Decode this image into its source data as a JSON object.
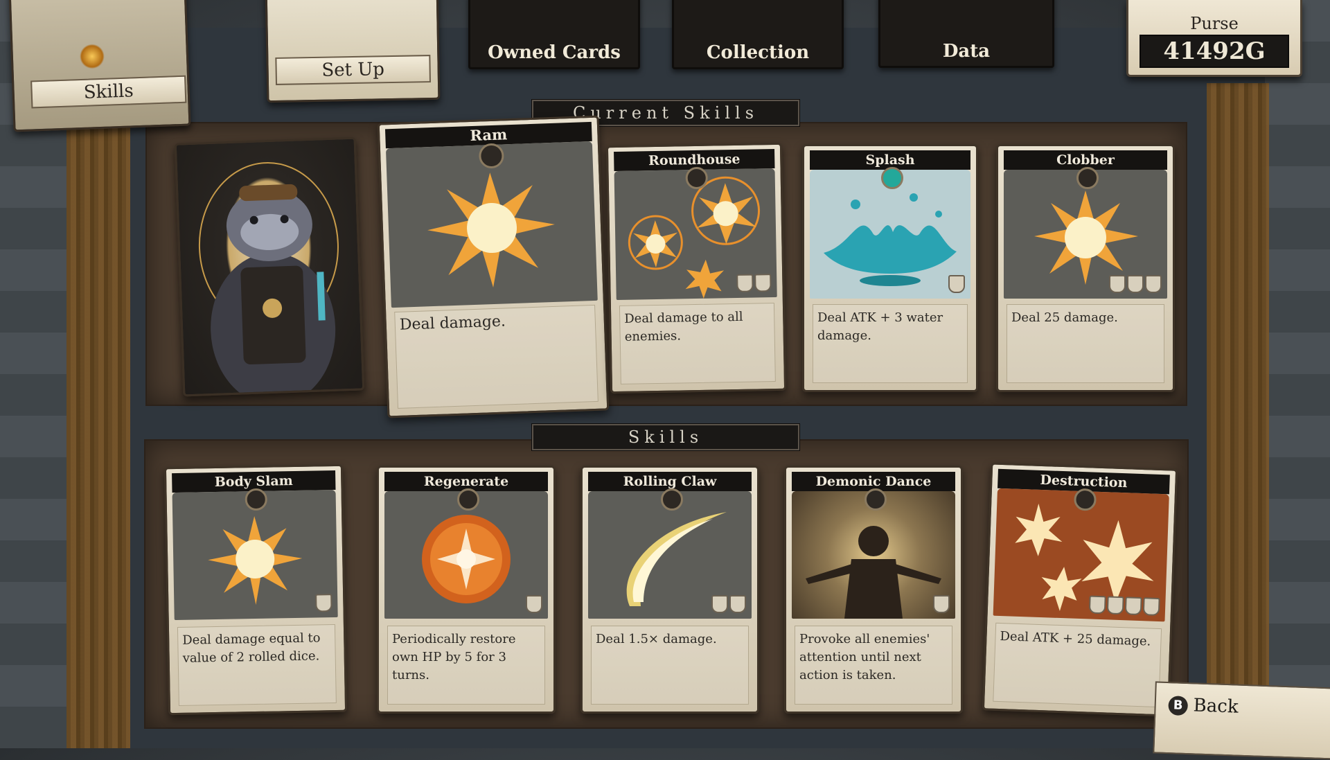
{
  "nav": {
    "skills": "Skills",
    "setup": "Set Up",
    "owned_cards": "Owned Cards",
    "collection": "Collection",
    "data": "Data"
  },
  "purse": {
    "label": "Purse",
    "amount": "41492G"
  },
  "sections": {
    "current": "Current Skills",
    "skills": "Skills"
  },
  "current_skills": [
    {
      "name": "Ram",
      "desc": "Deal damage.",
      "art": "burst-orange",
      "cost": 0
    },
    {
      "name": "Roundhouse",
      "desc": "Deal damage to all enemies.",
      "art": "burst-multi",
      "cost": 2
    },
    {
      "name": "Splash",
      "desc": "Deal ATK + 3 water damage.",
      "art": "splash-blue",
      "cost": 1
    },
    {
      "name": "Clobber",
      "desc": "Deal 25 damage.",
      "art": "burst-orange",
      "cost": 3
    }
  ],
  "skills": [
    {
      "name": "Body Slam",
      "desc": "Deal damage equal to value of 2 rolled dice.",
      "art": "burst-orange",
      "cost": 1
    },
    {
      "name": "Regenerate",
      "desc": "Periodically restore own HP by 5 for 3 turns.",
      "art": "orb-orange",
      "cost": 1
    },
    {
      "name": "Rolling Claw",
      "desc": "Deal 1.5× damage.",
      "art": "claw-yellow",
      "cost": 2
    },
    {
      "name": "Demonic Dance",
      "desc": "Provoke all enemies' attention until next action is taken.",
      "art": "figure-dark",
      "cost": 1
    },
    {
      "name": "Destruction",
      "desc": "Deal ATK + 25 damage.",
      "art": "burst-many",
      "cost": 4
    }
  ],
  "back": {
    "button": "B",
    "label": "Back"
  },
  "colors": {
    "burst": "#f0a43a",
    "burst_core": "#fbf1c8",
    "water": "#2aa3b2"
  }
}
